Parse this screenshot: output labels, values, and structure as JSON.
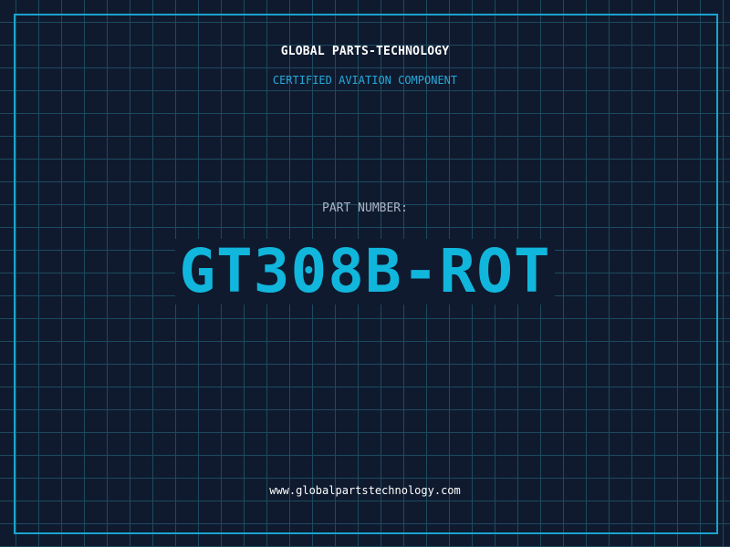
{
  "header": {
    "brand": "GLOBAL PARTS-TECHNOLOGY",
    "tagline": "CERTIFIED AVIATION COMPONENT"
  },
  "part": {
    "label": "PART NUMBER:",
    "number": "GT308B-ROT"
  },
  "footer": {
    "url": "www.globalpartstechnology.com"
  },
  "colors": {
    "background": "#0f1a2f",
    "grid": "#1d4a5e",
    "accent": "#1aa3cc",
    "part_number": "#11b6dc",
    "brand_text": "#ffffff",
    "label_text": "#a9b3c4"
  }
}
